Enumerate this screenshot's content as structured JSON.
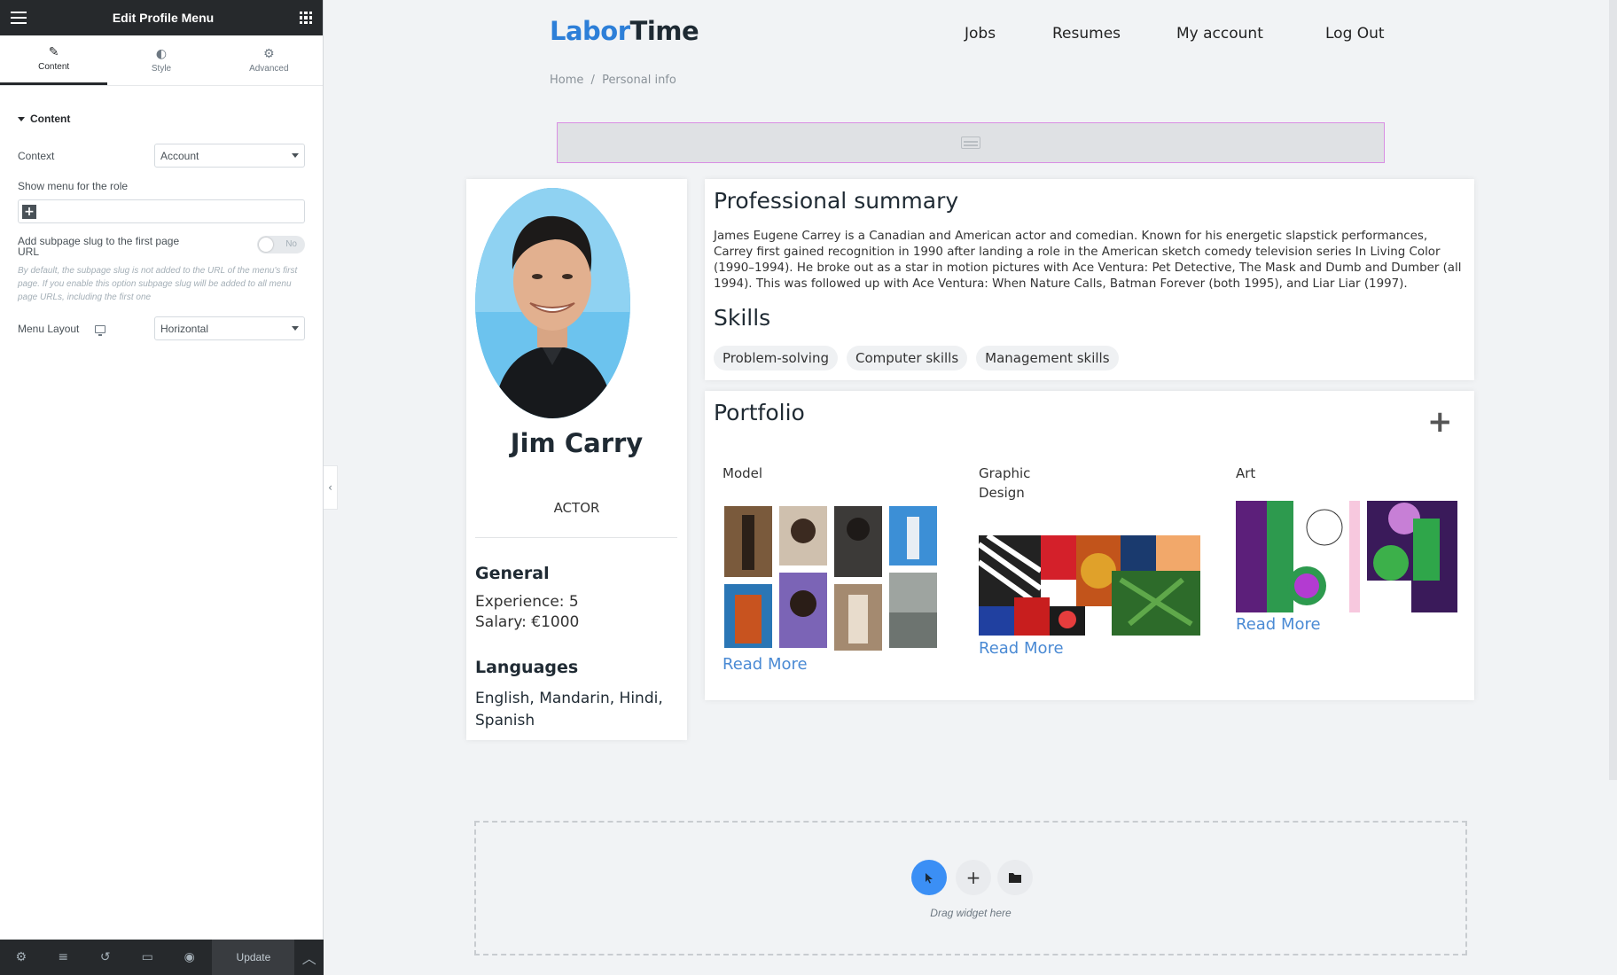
{
  "editor": {
    "title": "Edit Profile Menu",
    "tabs": [
      {
        "label": "Content",
        "icon": "pencil-icon"
      },
      {
        "label": "Style",
        "icon": "contrast-icon"
      },
      {
        "label": "Advanced",
        "icon": "gear-icon"
      }
    ],
    "section": "Content",
    "context_label": "Context",
    "context_value": "Account",
    "role_label": "Show menu for the role",
    "slug_label": "Add subpage slug to the first page URL",
    "slug_toggle": "No",
    "slug_desc": "By default, the subpage slug is not added to the URL of the menu's first page. If you enable this option subpage slug will be added to all menu page URLs, including the first one",
    "layout_label": "Menu Layout",
    "layout_value": "Horizontal",
    "update_label": "Update"
  },
  "site": {
    "logo_part1": "Labor",
    "logo_part2": "Time",
    "nav": [
      "Jobs",
      "Resumes",
      "My account",
      "Log Out"
    ],
    "breadcrumb_home": "Home",
    "breadcrumb_sep": "/",
    "breadcrumb_current": "Personal info"
  },
  "profile": {
    "name": "Jim Carry",
    "role": "ACTOR",
    "general_title": "General",
    "experience": "Experience: 5",
    "salary": "Salary: €1000",
    "languages_title": "Languages",
    "languages": "English, Mandarin, Hindi, Spanish"
  },
  "summary": {
    "title": "Professional summary",
    "text": "James Eugene Carrey is a Canadian and American actor and comedian. Known for his energetic slapstick performances, Carrey first gained recognition in 1990 after landing a role in the American sketch comedy television series In Living Color (1990–1994). He broke out as a star in motion pictures with Ace Ventura: Pet Detective, The Mask and Dumb and Dumber (all 1994). This was followed up with Ace Ventura: When Nature Calls, Batman Forever (both 1995), and Liar Liar (1997).",
    "skills_title": "Skills",
    "skills": [
      "Problem-solving",
      "Computer skills",
      "Management skills"
    ]
  },
  "portfolio": {
    "title": "Portfolio",
    "categories": [
      {
        "name": "Model",
        "link": "Read More"
      },
      {
        "name": "Graphic Design",
        "link": "Read More"
      },
      {
        "name": "Art",
        "link": "Read More"
      }
    ]
  },
  "dropzone": {
    "text": "Drag widget here"
  },
  "colors": {
    "brand_blue": "#2d7fd8",
    "link_blue": "#4a8ad4",
    "editor_dark": "#26292c",
    "dropzone_accent": "#3b8ff5"
  }
}
